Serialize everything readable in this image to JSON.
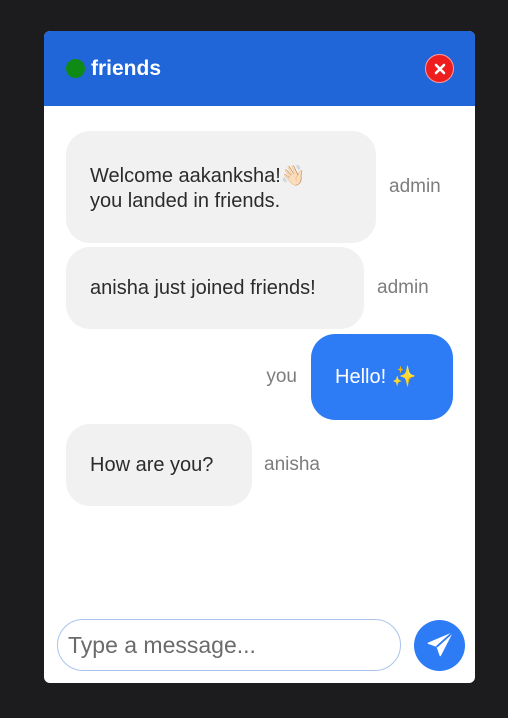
{
  "header": {
    "room_name": "friends",
    "status_color": "#0f8a14",
    "status_icon": "online-dot-icon",
    "close_icon": "close-icon"
  },
  "messages": [
    {
      "direction": "incoming",
      "lines": [
        "Welcome aakanksha!👋🏻",
        "you landed in friends."
      ],
      "sender": "admin"
    },
    {
      "direction": "incoming",
      "text": "anisha just joined friends!",
      "sender": "admin"
    },
    {
      "direction": "outgoing",
      "text": "Hello! ✨",
      "sender": "you"
    },
    {
      "direction": "incoming",
      "text": "How are you?",
      "sender": "anisha"
    }
  ],
  "composer": {
    "placeholder": "Type a message...",
    "value": "",
    "send_icon": "send-paper-plane-icon"
  },
  "colors": {
    "header": "#2166d9",
    "incoming_bubble": "#f1f1f1",
    "outgoing_bubble": "#2e7cf5",
    "close_button": "#ef1e1e",
    "background": "#1c1c1e"
  }
}
